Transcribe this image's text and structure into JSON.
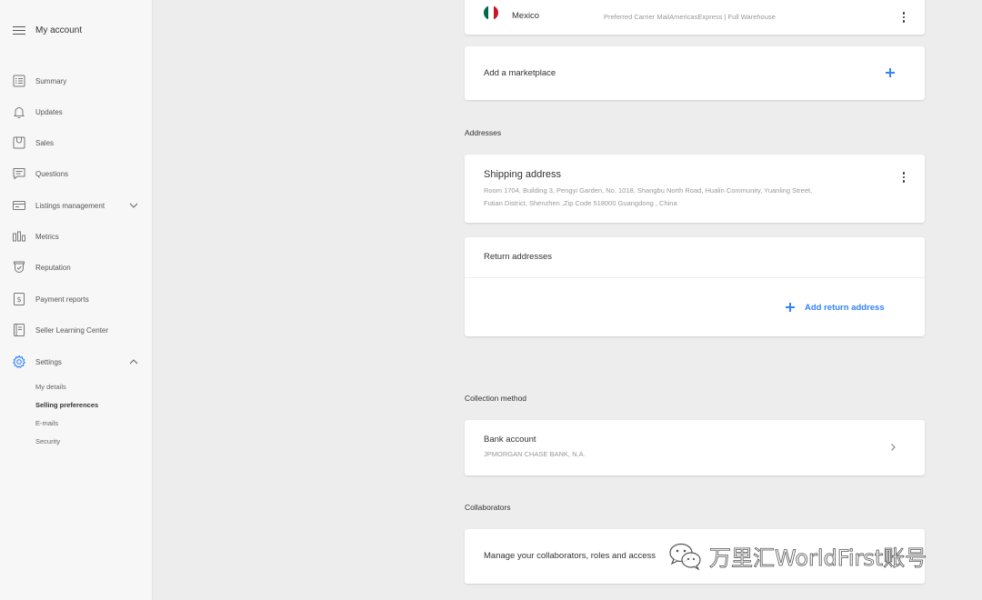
{
  "sidebar": {
    "title": "My account",
    "items": [
      {
        "label": "Summary",
        "icon": "summary-icon"
      },
      {
        "label": "Updates",
        "icon": "bell-icon"
      },
      {
        "label": "Sales",
        "icon": "sales-icon"
      },
      {
        "label": "Questions",
        "icon": "chat-icon"
      },
      {
        "label": "Listings management",
        "icon": "listings-icon",
        "expandable": true,
        "expanded": false
      },
      {
        "label": "Metrics",
        "icon": "bar-chart-icon"
      },
      {
        "label": "Reputation",
        "icon": "reputation-icon"
      },
      {
        "label": "Payment reports",
        "icon": "dollar-doc-icon"
      },
      {
        "label": "Seller Learning Center",
        "icon": "book-icon"
      },
      {
        "label": "Settings",
        "icon": "gear-icon",
        "expandable": true,
        "expanded": true
      }
    ],
    "settings_sub": [
      {
        "label": "My details",
        "active": false
      },
      {
        "label": "Selling preferences",
        "active": true
      },
      {
        "label": "E-mails",
        "active": false
      },
      {
        "label": "Security",
        "active": false
      }
    ]
  },
  "marketplace": {
    "country": "Mexico",
    "flag_colors": [
      "#006847",
      "#ffffff",
      "#ce1126"
    ],
    "services": "Preferred Carrier MailAmericasExpress  |  Full Warehouse"
  },
  "add_marketplace": {
    "label": "Add a marketplace"
  },
  "addresses": {
    "section_title": "Addresses",
    "shipping": {
      "title": "Shipping address",
      "line1": "Room 1704, Building 3, Pengyi Garden, No. 1018, Shangbu North Road, Hualin Community, Yuanling Street,",
      "line2": "Futian District, Shenzhen ,Zip Code 518000 Guangdong , China"
    },
    "returns": {
      "title": "Return addresses",
      "add_label": "Add return address"
    }
  },
  "collection": {
    "section_title": "Collection method",
    "title": "Bank account",
    "bank": "JPMORGAN CHASE BANK, N.A."
  },
  "collaborators": {
    "section_title": "Collaborators",
    "text": "Manage your collaborators, roles and access"
  },
  "watermark": {
    "text": "万里汇WorldFirst账号"
  },
  "colors": {
    "accent": "#3483fa",
    "sidebar_bg": "#f7f7f7",
    "page_bg": "#ededed",
    "settings_icon": "#3483fa"
  }
}
